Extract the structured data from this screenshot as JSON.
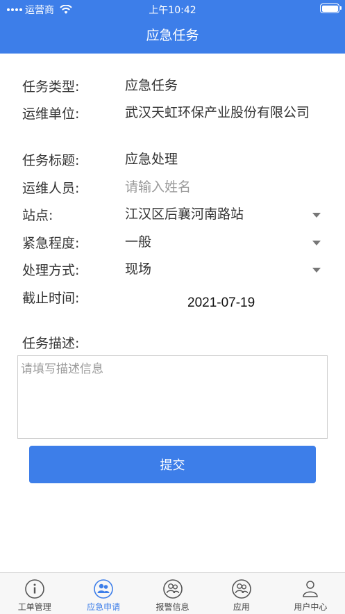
{
  "status_bar": {
    "carrier": "运营商",
    "time": "上午10:42"
  },
  "header": {
    "title": "应急任务"
  },
  "form": {
    "task_type": {
      "label": "任务类型:",
      "value": "应急任务"
    },
    "unit": {
      "label": "运维单位:",
      "value": "武汉天虹环保产业股份有限公司"
    },
    "task_title": {
      "label": "任务标题:",
      "value": "应急处理"
    },
    "personnel": {
      "label": "运维人员:",
      "placeholder": "请输入姓名"
    },
    "station": {
      "label": "站点:",
      "value": "江汉区后襄河南路站"
    },
    "urgency": {
      "label": "紧急程度:",
      "value": "一般"
    },
    "method": {
      "label": "处理方式:",
      "value": "现场"
    },
    "deadline": {
      "label": "截止时间:",
      "value": "2021-07-19"
    },
    "description": {
      "label": "任务描述:",
      "placeholder": "请填写描述信息"
    },
    "submit_label": "提交"
  },
  "tabbar": {
    "active_color": "#3d7ee9",
    "items": [
      {
        "label": "工单管理",
        "icon": "info-icon"
      },
      {
        "label": "应急申请",
        "icon": "users-icon",
        "active": true
      },
      {
        "label": "报警信息",
        "icon": "users-icon"
      },
      {
        "label": "应用",
        "icon": "users-icon"
      },
      {
        "label": "用户中心",
        "icon": "user-icon"
      }
    ]
  }
}
